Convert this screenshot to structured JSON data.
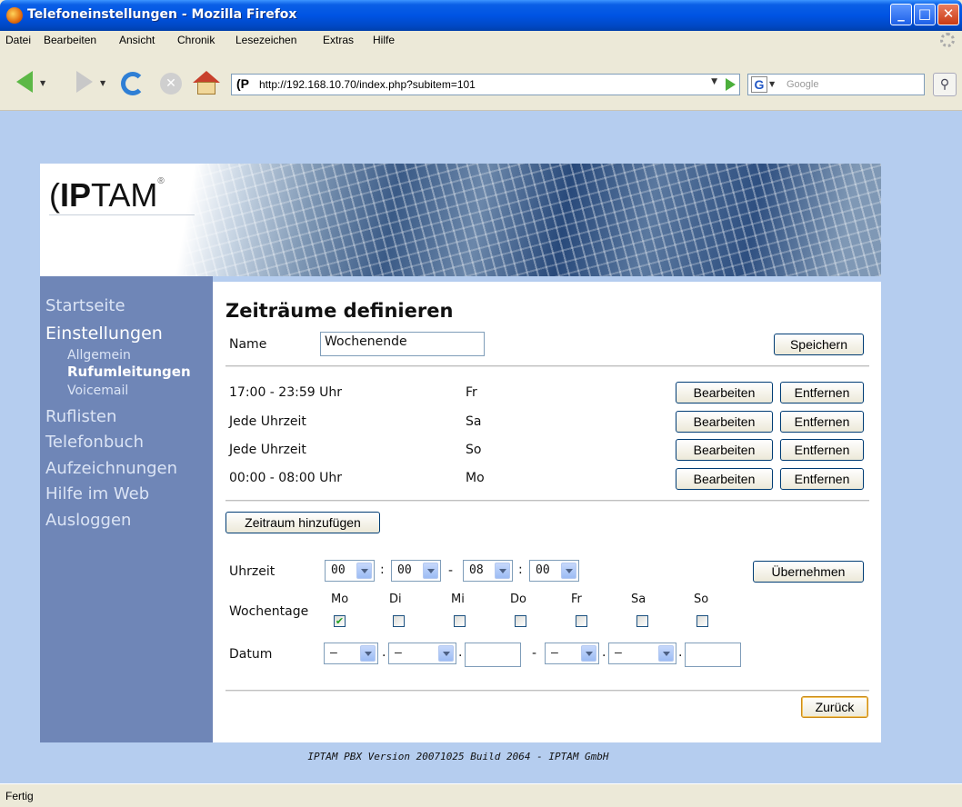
{
  "window": {
    "title": "Telefoneinstellungen - Mozilla Firefox",
    "min_glyph": "_",
    "max_glyph": "□",
    "close_glyph": "✕"
  },
  "menu": [
    "Datei",
    "Bearbeiten",
    "Ansicht",
    "Chronik",
    "Lesezeichen",
    "Extras",
    "Hilfe"
  ],
  "toolbar": {
    "url": "http://192.168.10.70/index.php?subitem=101",
    "favicon_text": "(P",
    "search_placeholder": "Google",
    "search_engine_letter": "G",
    "stop_glyph": "✕",
    "search_glyph": "⚲"
  },
  "banner": {
    "logo_bold": "IP",
    "logo_light": "TAM",
    "logo_prefix": "(",
    "logo_mark": "®"
  },
  "sidebar": {
    "items": [
      {
        "label": "Startseite"
      },
      {
        "label": "Einstellungen"
      },
      {
        "label": "Allgemein"
      },
      {
        "label": "Rufumleitungen"
      },
      {
        "label": "Voicemail"
      },
      {
        "label": "Ruflisten"
      },
      {
        "label": "Telefonbuch"
      },
      {
        "label": "Aufzeichnungen"
      },
      {
        "label": "Hilfe im Web"
      },
      {
        "label": "Ausloggen"
      }
    ]
  },
  "main": {
    "heading": "Zeiträume definieren",
    "name_label": "Name",
    "name_value": "Wochenende",
    "save_label": "Speichern",
    "edit_label": "Bearbeiten",
    "remove_label": "Entfernen",
    "periods": [
      {
        "time": "17:00 - 23:59 Uhr",
        "day": "Fr"
      },
      {
        "time": "Jede Uhrzeit",
        "day": "Sa"
      },
      {
        "time": "Jede Uhrzeit",
        "day": "So"
      },
      {
        "time": "00:00 - 08:00 Uhr",
        "day": "Mo"
      }
    ],
    "add_period_label": "Zeitraum hinzufügen",
    "time_label": "Uhrzeit",
    "time_values": [
      "00",
      "00",
      "08",
      "00"
    ],
    "time_sep_colon": ":",
    "time_sep_dash": "-",
    "apply_label": "Übernehmen",
    "weekdays_label": "Wochentage",
    "weekdays": [
      {
        "day": "Mo",
        "checked": true
      },
      {
        "day": "Di",
        "checked": false
      },
      {
        "day": "Mi",
        "checked": false
      },
      {
        "day": "Do",
        "checked": false
      },
      {
        "day": "Fr",
        "checked": false
      },
      {
        "day": "Sa",
        "checked": false
      },
      {
        "day": "So",
        "checked": false
      }
    ],
    "check_glyph": "✔",
    "date_label": "Datum",
    "date_placeholder_select": "–",
    "date_placeholder_dash": "—",
    "date_sep_dot": ".",
    "date_sep_dash": "-",
    "back_label": "Zurück"
  },
  "footer": "IPTAM PBX Version 20071025 Build 2064 - IPTAM GmbH",
  "status": "Fertig"
}
